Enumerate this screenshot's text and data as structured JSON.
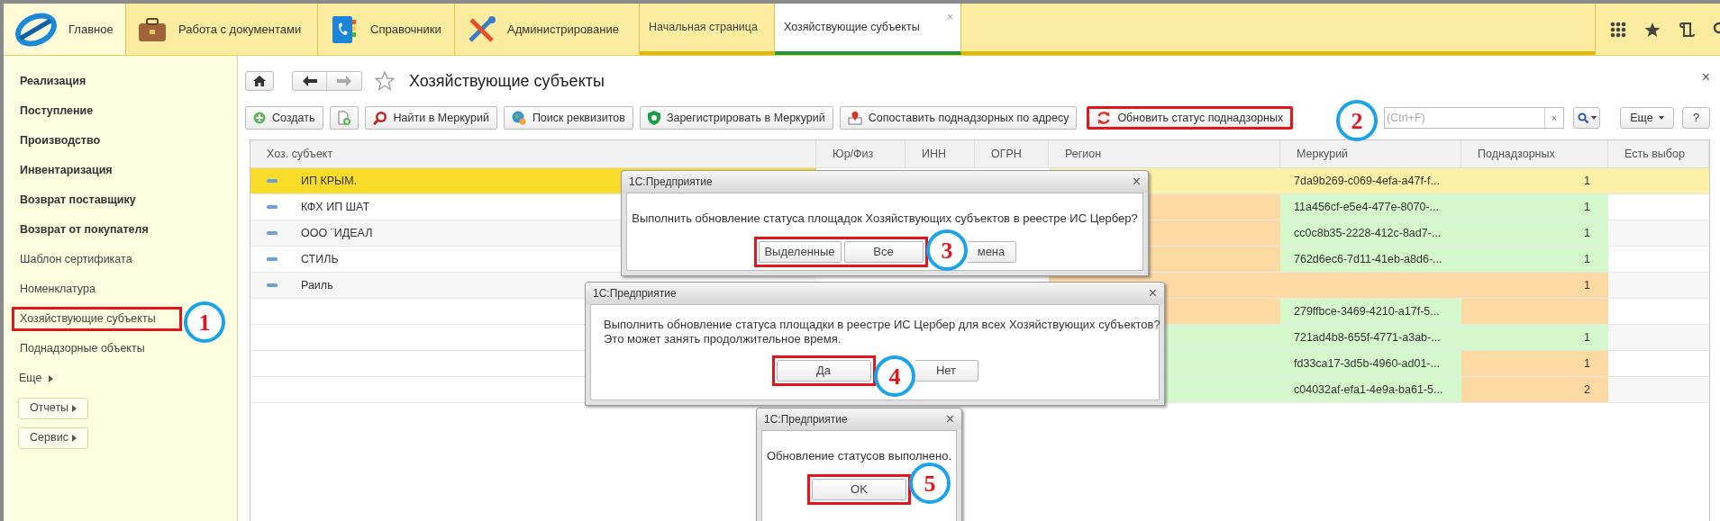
{
  "top_bar": {
    "sections": [
      {
        "label": "Главное",
        "selected": true
      },
      {
        "label": "Работа с документами",
        "selected": false
      },
      {
        "label": "Справочники",
        "selected": false
      },
      {
        "label": "Администрирование",
        "selected": false
      }
    ],
    "open_tabs": [
      {
        "label": "Начальная страница",
        "selected": false
      },
      {
        "label": "Хозяйствующие субъекты",
        "selected": true,
        "close": "×"
      }
    ]
  },
  "sidebar": {
    "items": [
      {
        "label": "Реализация",
        "kind": "section",
        "highlighted": false
      },
      {
        "label": "Поступление",
        "kind": "section",
        "highlighted": false
      },
      {
        "label": "Производство",
        "kind": "section",
        "highlighted": false
      },
      {
        "label": "Инвентаризация",
        "kind": "section",
        "highlighted": false
      },
      {
        "label": "Возврат поставщику",
        "kind": "section",
        "highlighted": false
      },
      {
        "label": "Возврат от покупателя",
        "kind": "section",
        "highlighted": false
      },
      {
        "label": "Шаблон сертификата",
        "kind": "item",
        "highlighted": false
      },
      {
        "label": "Номенклатура",
        "kind": "item",
        "highlighted": false
      },
      {
        "label": "Хозяйствующие субъекты",
        "kind": "item",
        "highlighted": true
      },
      {
        "label": "Поднадзорные объекты",
        "kind": "item",
        "highlighted": false
      },
      {
        "label": "Еще",
        "kind": "more",
        "highlighted": false
      },
      {
        "label": "Отчеты",
        "kind": "button",
        "highlighted": false
      },
      {
        "label": "Сервис",
        "kind": "button",
        "highlighted": false
      }
    ]
  },
  "form": {
    "title": "Хозяйствующие субъекты",
    "close": "×",
    "toolbar": [
      {
        "label": "Создать",
        "highlighted": false
      },
      {
        "highlighted": false
      },
      {
        "label": "Найти в Меркурий",
        "highlighted": false
      },
      {
        "label": "Поиск реквизитов",
        "highlighted": false
      },
      {
        "label": "Зарегистрировать в Меркурий",
        "highlighted": false
      },
      {
        "label": "Сопоставить поднадзорных по адресу",
        "highlighted": false
      },
      {
        "label": "Обновить статус поднадзорных",
        "highlighted": true
      }
    ],
    "search": {
      "placeholder": "(Ctrl+F)",
      "clear": "×"
    },
    "more": "Еще",
    "help": "?"
  },
  "table": {
    "columns": [
      "Хоз. субъект",
      "Юр/Физ",
      "ИНН",
      "ОГРН",
      "Регион",
      "Меркурий",
      "Поднадзорных",
      "Есть выбор"
    ],
    "rows": [
      {
        "name": "ИП КРЫМ.",
        "selected": true,
        "cells": [
          {},
          {
            "text": "7da9b269-c069-4efa-a47f-f..."
          },
          {
            "text": "1"
          }
        ]
      },
      {
        "name": "КФХ ИП ШАТ",
        "selected": false,
        "cells": [
          {
            "color": "#fdd9a4"
          },
          {
            "text": "11a456cf-e5e4-477e-8070-...",
            "color": "#d4f8cc"
          },
          {
            "text": "1",
            "color": "#d4f8cc"
          }
        ]
      },
      {
        "name": "ООО ¨ИДЕАЛ",
        "selected": false,
        "cells": [
          {
            "color": "#fdd9a4"
          },
          {
            "text": "cc0c8b35-2228-412c-8ad7-...",
            "color": "#d4f8cc"
          },
          {
            "text": "1",
            "color": "#d4f8cc"
          }
        ]
      },
      {
        "name": "СТИЛЬ",
        "selected": false,
        "cells": [
          {
            "color": "#fdd9a4"
          },
          {
            "text": "762d6ec6-7d11-41eb-a8d6-...",
            "color": "#d4f8cc"
          },
          {
            "text": "1",
            "color": "#d4f8cc"
          }
        ]
      },
      {
        "name": "Раиль",
        "selected": false,
        "cells": [
          {
            "color": "#fdd9a4"
          },
          {
            "color": "#fdd9a4"
          },
          {
            "text": "1",
            "color": "#fdd9a4"
          }
        ]
      },
      {
        "selected": false,
        "cells": [
          {
            "color": "#fdd9a4"
          },
          {
            "text": "279ffbce-3469-4210-a17f-5...",
            "color": "#d4f8cc"
          },
          {
            "color": "#fdd9a4"
          }
        ]
      },
      {
        "selected": false,
        "cells": [
          {
            "color": "#d4f8cc"
          },
          {
            "text": "721ad4b8-655f-4771-a3ab-...",
            "color": "#d4f8cc"
          },
          {
            "text": "1",
            "color": "#d4f8cc"
          }
        ]
      },
      {
        "selected": false,
        "cells": [
          {
            "color": "#d4f8cc"
          },
          {
            "text": "fd33ca17-3d5b-4960-ad01-...",
            "color": "#d4f8cc"
          },
          {
            "text": "1",
            "color": "#fdd9a4"
          }
        ]
      },
      {
        "selected": false,
        "cells": [
          {
            "color": "#d4f8cc"
          },
          {
            "text": "c04032af-efa1-4e9a-ba61-5...",
            "color": "#d4f8cc"
          },
          {
            "text": "2",
            "color": "#fdd9a4"
          }
        ]
      }
    ]
  },
  "dialogs": [
    {
      "title": "1С:Предприятие",
      "close": "×",
      "message": "Выполнить обновление статуса площадок Хозяйствующих субъектов в реестре ИС Цербер?",
      "buttons": [
        {
          "label": "Выделенные",
          "highlighted": true
        },
        {
          "label": "Все",
          "highlighted": true
        },
        {
          "label": "мена",
          "highlighted": false
        }
      ]
    },
    {
      "title": "1С:Предприятие",
      "close": "×",
      "message": "Выполнить обновление статуса площадки в реестре ИС Цербер для всех Хозяйствующих субъектов?\nЭто может занять продолжительное время.",
      "buttons": [
        {
          "label": "Да",
          "highlighted": true
        },
        {
          "label": "Нет",
          "highlighted": false
        }
      ]
    },
    {
      "title": "1С:Предприятие",
      "close": "×",
      "message": "Обновление статусов выполнено.",
      "buttons": [
        {
          "label": "OK",
          "highlighted": true
        }
      ]
    }
  ],
  "annotations": [
    {
      "number": "1"
    },
    {
      "number": "2"
    },
    {
      "number": "3"
    },
    {
      "number": "4"
    },
    {
      "number": "5"
    }
  ]
}
